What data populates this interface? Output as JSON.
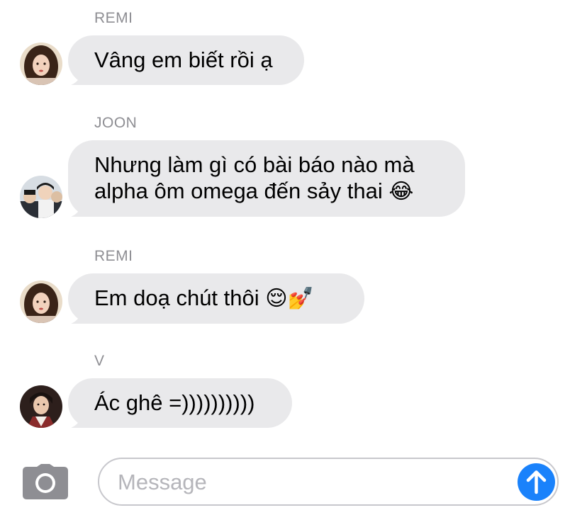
{
  "messages": [
    {
      "sender": "REMI",
      "lines": [
        "Vâng em biết rồi ạ"
      ],
      "emoji": "",
      "avatar": "remi-avatar"
    },
    {
      "sender": "JOON",
      "lines": [
        "Nhưng làm gì có bài báo nào mà",
        "alpha ôm omega đến sảy thai"
      ],
      "emoji": "😂",
      "avatar": "joon-avatar"
    },
    {
      "sender": "REMI",
      "lines": [
        "Em doạ chút thôi"
      ],
      "emoji": "😌💅",
      "avatar": "remi-avatar"
    },
    {
      "sender": "V",
      "lines": [
        "Ác ghê =))))))))))"
      ],
      "emoji": "",
      "avatar": "v-avatar"
    }
  ],
  "composer": {
    "placeholder": "Message",
    "camera_icon": "camera-icon",
    "send_icon": "arrow-up-icon"
  },
  "colors": {
    "bubble": "#e9e9eb",
    "send": "#1a82fb",
    "sender_label": "#8e8e93"
  }
}
